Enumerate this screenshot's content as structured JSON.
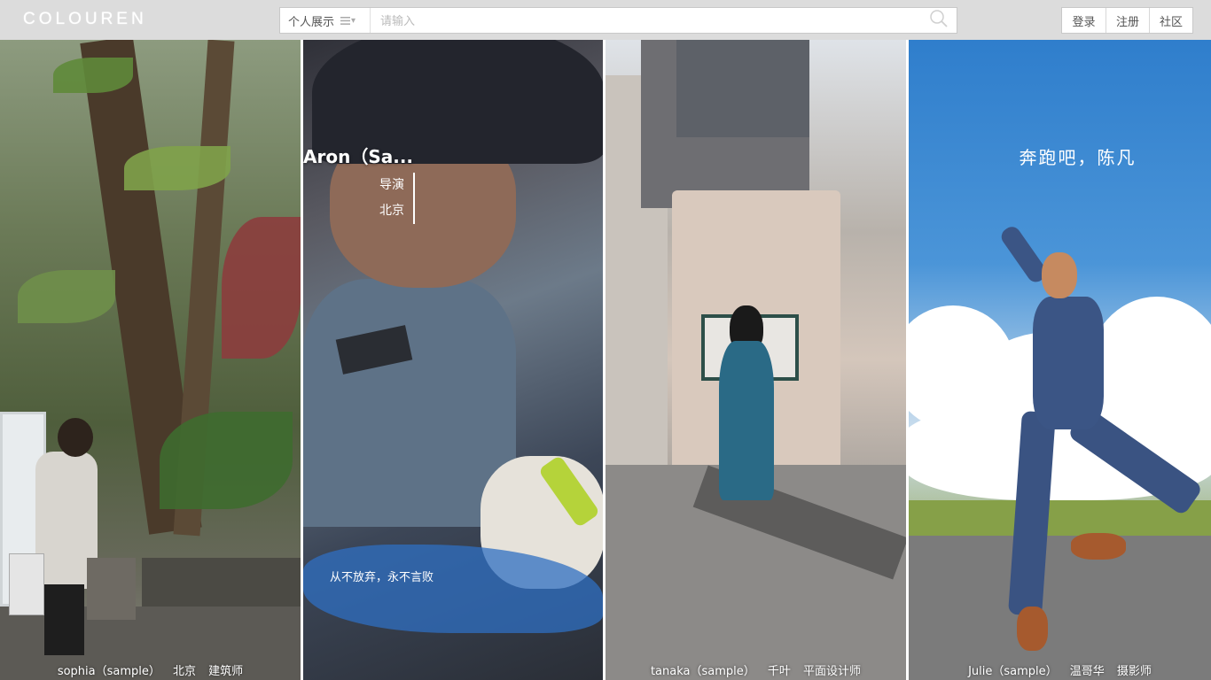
{
  "header": {
    "logo": "COLOUREN",
    "search": {
      "category_label": "个人展示",
      "placeholder": "请输入"
    },
    "auth": {
      "login": "登录",
      "register": "注册",
      "community": "社区"
    }
  },
  "panels": [
    {
      "name": "sophia（sample）",
      "city": "北京",
      "role": "建筑师"
    },
    {
      "overlay_name": "Aron（Sa...",
      "role": "导演",
      "city": "北京",
      "motto": "从不放弃，永不言败"
    },
    {
      "name": "tanaka（sample）",
      "city": "千叶",
      "role": "平面设计师"
    },
    {
      "name": "Julie（sample）",
      "city": "温哥华",
      "role": "摄影师",
      "slogan": "奔跑吧，陈凡"
    }
  ],
  "icons": {
    "menu": "menu-icon",
    "search": "search-icon",
    "next": "chevron-right-icon"
  }
}
